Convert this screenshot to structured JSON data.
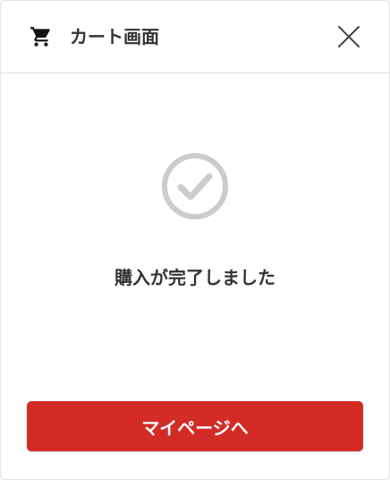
{
  "header": {
    "title": "カート画面",
    "icon": "cart-icon",
    "close_icon": "close-icon"
  },
  "status": {
    "icon": "check-circle-icon",
    "message": "購入が完了しました"
  },
  "actions": {
    "mypage_label": "マイページへ"
  },
  "colors": {
    "accent": "#d32b25",
    "text": "#333333",
    "check": "#cccccc"
  }
}
